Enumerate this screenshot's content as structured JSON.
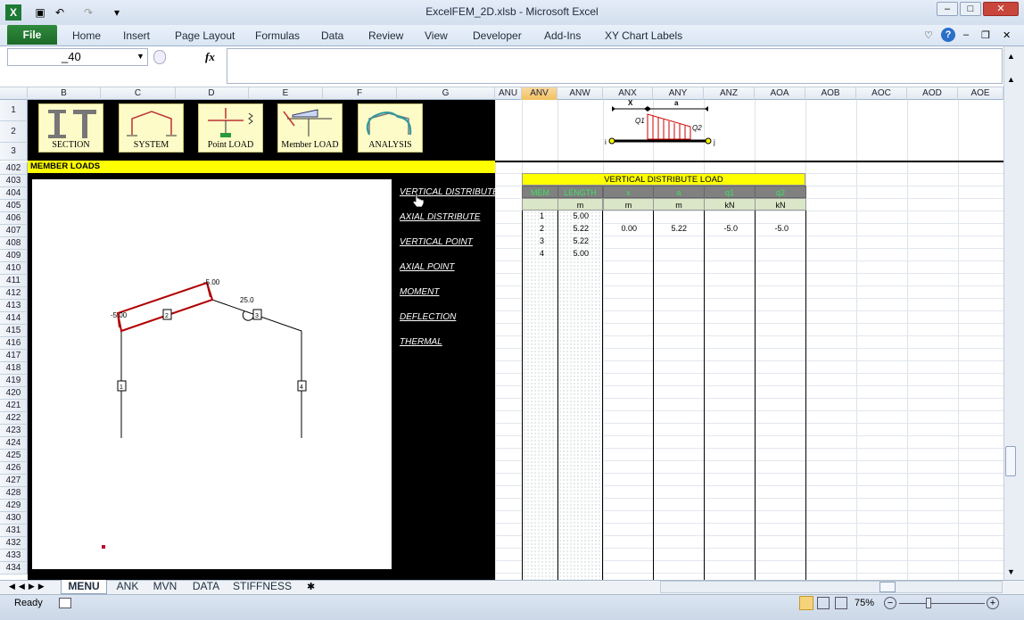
{
  "app": {
    "title": "ExcelFEM_2D.xlsb  -  Microsoft Excel"
  },
  "ribbon": {
    "file_label": "File",
    "tabs": [
      "Home",
      "Insert",
      "Page Layout",
      "Formulas",
      "Data",
      "Review",
      "View",
      "Developer",
      "Add-Ins",
      "XY Chart Labels"
    ]
  },
  "formula_bar": {
    "name_box": "_40",
    "fx_label": "fx",
    "formula": ""
  },
  "columns_left": [
    "B",
    "C",
    "D",
    "E",
    "F",
    "G"
  ],
  "columns_right": [
    "ANU",
    "ANV",
    "ANW",
    "ANX",
    "ANY",
    "ANZ",
    "AOA",
    "AOB",
    "AOC",
    "AOD",
    "AOE"
  ],
  "rows_top": [
    "1",
    "2",
    "3"
  ],
  "rows_main": [
    "402",
    "403",
    "404",
    "405",
    "406",
    "407",
    "408",
    "409",
    "410",
    "411",
    "412",
    "413",
    "414",
    "415",
    "416",
    "417",
    "418",
    "419",
    "420",
    "421",
    "422",
    "423",
    "424",
    "425",
    "426",
    "427",
    "428",
    "429",
    "430",
    "431",
    "432",
    "433",
    "434"
  ],
  "menu_buttons": [
    "SECTION",
    "SYSTEM",
    "Point  LOAD",
    "Member LOAD",
    "ANALYSIS"
  ],
  "member_loads_title": "MEMBER LOADS",
  "load_links": [
    "VERTICAL DISTRIBUTE",
    "AXIAL DISTRIBUTE",
    "VERTICAL POINT",
    "AXIAL POINT",
    "MOMENT",
    "DEFLECTION",
    "THERMAL"
  ],
  "diagram": {
    "labels": {
      "x": "X",
      "a": "a",
      "q1": "Q1",
      "q2": "Q2",
      "i": "i",
      "j": "j"
    }
  },
  "frame": {
    "load_left": "-5.00",
    "load_right": "-5.00",
    "moment": "25.0",
    "members": [
      "1",
      "2",
      "3",
      "4"
    ]
  },
  "table": {
    "title": "VERTICAL DISTRIBUTE LOAD",
    "headers": [
      "MEM",
      "LENGTH",
      "x",
      "a",
      "q1",
      "q2"
    ],
    "units": [
      "",
      "m",
      "m",
      "m",
      "kN",
      "kN"
    ],
    "rows": [
      {
        "mem": "1",
        "len": "5.00",
        "x": "",
        "a": "",
        "q1": "",
        "q2": ""
      },
      {
        "mem": "2",
        "len": "5.22",
        "x": "0.00",
        "a": "5.22",
        "q1": "-5.0",
        "q2": "-5.0"
      },
      {
        "mem": "3",
        "len": "5.22",
        "x": "",
        "a": "",
        "q1": "",
        "q2": ""
      },
      {
        "mem": "4",
        "len": "5.00",
        "x": "",
        "a": "",
        "q1": "",
        "q2": ""
      }
    ]
  },
  "sheet_tabs": [
    "MENU",
    "ANK",
    "MVN",
    "DATA",
    "STIFFNESS"
  ],
  "status": {
    "ready": "Ready",
    "zoom": "75%"
  },
  "colors": {
    "yellow": "#ffff00",
    "green_header": "#3fe060",
    "file_tab": "#1c6a28",
    "load_red": "#c00000"
  }
}
